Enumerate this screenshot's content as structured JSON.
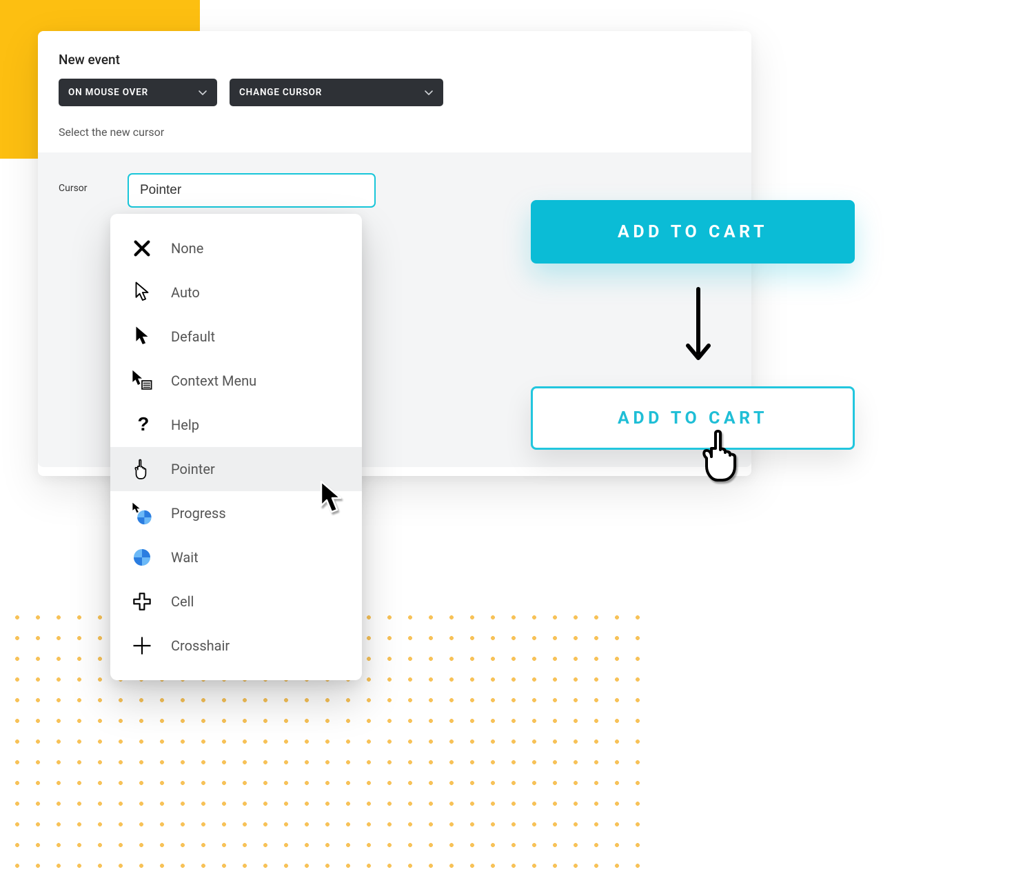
{
  "panel": {
    "title": "New event",
    "trigger_label": "ON MOUSE OVER",
    "action_label": "CHANGE CURSOR",
    "subtitle": "Select the new cursor",
    "cursor_field_label": "Cursor",
    "cursor_field_value": "Pointer"
  },
  "dropdown": {
    "items": [
      {
        "label": "None",
        "icon": "x-icon"
      },
      {
        "label": "Auto",
        "icon": "arrow-outline-icon"
      },
      {
        "label": "Default",
        "icon": "arrow-solid-icon"
      },
      {
        "label": "Context Menu",
        "icon": "context-menu-icon"
      },
      {
        "label": "Help",
        "icon": "help-icon"
      },
      {
        "label": "Pointer",
        "icon": "hand-icon"
      },
      {
        "label": "Progress",
        "icon": "progress-icon"
      },
      {
        "label": "Wait",
        "icon": "wait-icon"
      },
      {
        "label": "Cell",
        "icon": "cell-plus-icon"
      },
      {
        "label": "Crosshair",
        "icon": "crosshair-icon"
      }
    ],
    "selected_index": 5
  },
  "preview": {
    "button_filled_label": "ADD TO CART",
    "button_outline_label": "ADD TO CART"
  },
  "colors": {
    "accent": "#0bbcd6",
    "accent_border": "#22c6de",
    "yellow": "#fdbf11"
  }
}
